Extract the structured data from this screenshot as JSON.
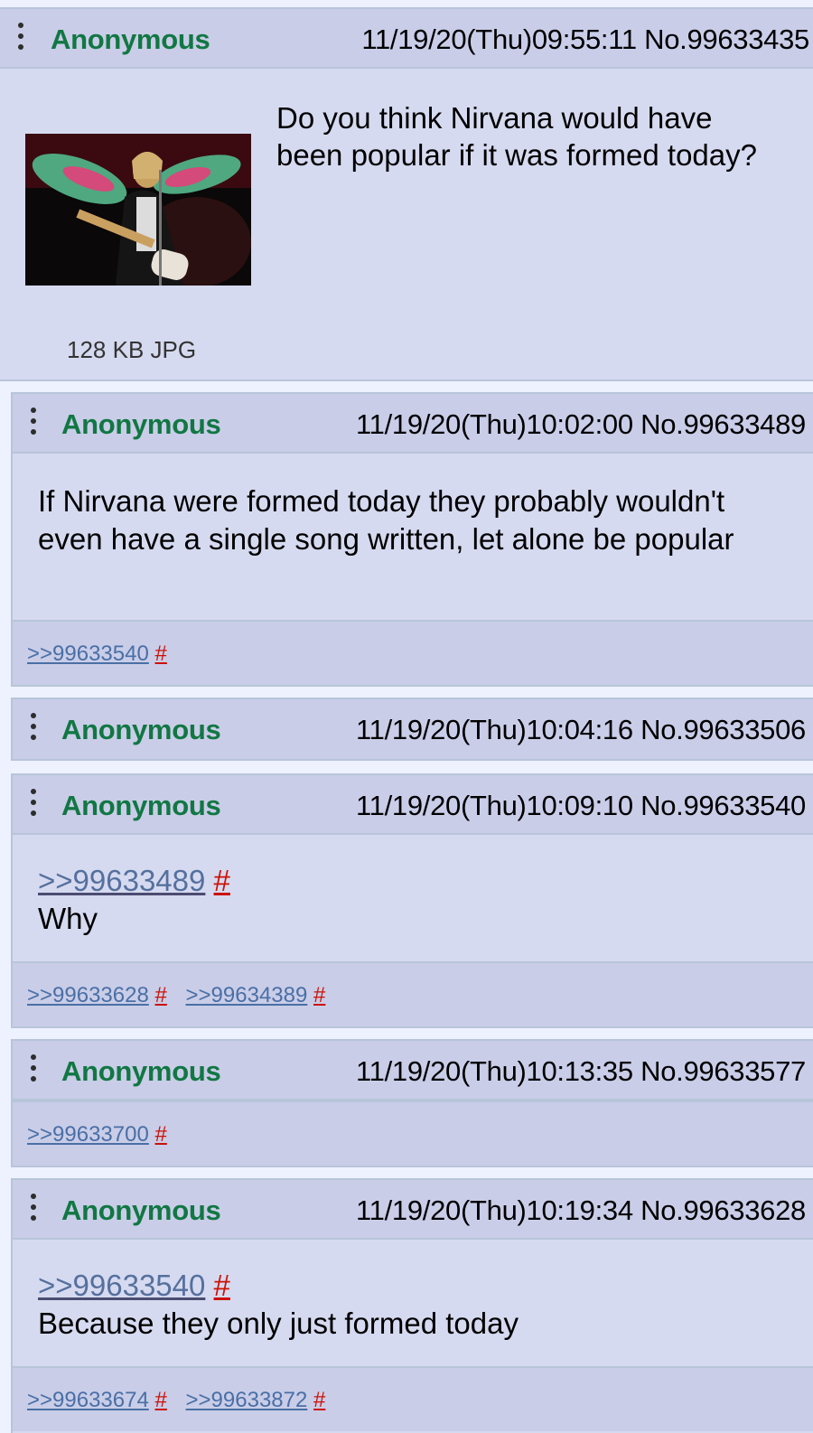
{
  "op": {
    "name": "Anonymous",
    "meta": "11/19/20(Thu)09:55:11 No.99633435",
    "text": "Do you think Nirvana would have been popular if it was formed today?",
    "file_info": "128 KB JPG"
  },
  "posts": [
    {
      "name": "Anonymous",
      "meta": "11/19/20(Thu)10:02:00 No.99633489",
      "text": "If Nirvana were formed today they probably wouldn't even have a single song written, let alone be popular",
      "backlinks": [
        ">>99633540"
      ]
    },
    {
      "name": "Anonymous",
      "meta": "11/19/20(Thu)10:04:16 No.99633506"
    },
    {
      "name": "Anonymous",
      "meta": "11/19/20(Thu)10:09:10 No.99633540",
      "quote": ">>99633489",
      "text": "Why",
      "backlinks": [
        ">>99633628",
        ">>99634389"
      ]
    },
    {
      "name": "Anonymous",
      "meta": "11/19/20(Thu)10:13:35 No.99633577",
      "backlinks": [
        ">>99633700"
      ]
    },
    {
      "name": "Anonymous",
      "meta": "11/19/20(Thu)10:19:34 No.99633628",
      "quote": ">>99633540",
      "text": "Because they only just formed today",
      "backlinks": [
        ">>99633674",
        ">>99633872"
      ]
    }
  ],
  "hash_symbol": "#",
  "colors": {
    "name": "#117743",
    "post_bg": "#d6daf0",
    "header_bg": "#c9cde8",
    "quote_link": "#4a6fa5",
    "hash": "#cc1105"
  },
  "icons": {
    "menu": "vertical-ellipsis-icon"
  }
}
